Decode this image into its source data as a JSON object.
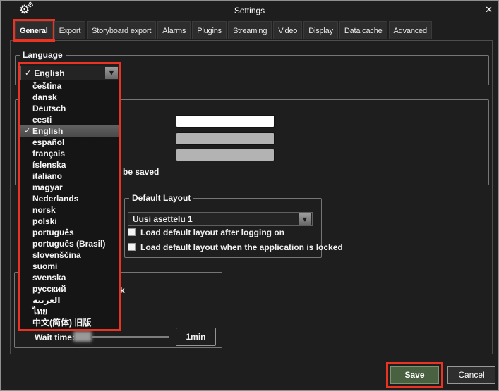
{
  "window": {
    "title": "Settings"
  },
  "icons": {
    "gear_icon": "⚙",
    "close_icon": "✕",
    "check_icon": "✓",
    "dropdown_arrow_icon": "▼"
  },
  "tabs": [
    {
      "label": "General",
      "active": true,
      "highlighted": true
    },
    {
      "label": "Export"
    },
    {
      "label": "Storyboard export"
    },
    {
      "label": "Alarms"
    },
    {
      "label": "Plugins"
    },
    {
      "label": "Streaming"
    },
    {
      "label": "Video"
    },
    {
      "label": "Display"
    },
    {
      "label": "Data cache"
    },
    {
      "label": "Advanced"
    }
  ],
  "language": {
    "group_title": "Language",
    "selected": "English",
    "options": [
      {
        "label": "čeština"
      },
      {
        "label": "dansk"
      },
      {
        "label": "Deutsch"
      },
      {
        "label": "eesti"
      },
      {
        "label": "English",
        "selected": true
      },
      {
        "label": "español"
      },
      {
        "label": "français"
      },
      {
        "label": "íslenska"
      },
      {
        "label": "italiano"
      },
      {
        "label": "magyar"
      },
      {
        "label": "Nederlands"
      },
      {
        "label": "norsk"
      },
      {
        "label": "polski"
      },
      {
        "label": "português"
      },
      {
        "label": "português (Brasil)"
      },
      {
        "label": "slovenščina"
      },
      {
        "label": "suomi"
      },
      {
        "label": "svenska"
      },
      {
        "label": "русский"
      },
      {
        "label": "العربية"
      },
      {
        "label": "ไทย"
      },
      {
        "label": "中文(简体) 旧版"
      }
    ]
  },
  "restart_section": {
    "partial_text": "be saved",
    "field_values": [
      "",
      "",
      ""
    ]
  },
  "default_layout": {
    "group_title": "Default Layout",
    "selected_layout": "Uusi asettelu 1",
    "checkboxes": [
      {
        "label": "Load default layout after logging on",
        "checked": false
      },
      {
        "label": "Load default layout when the application is locked",
        "checked": false
      }
    ]
  },
  "wait_section": {
    "partial_text": "k",
    "wait_time_label": "Wait time:",
    "wait_time_value": "1min"
  },
  "buttons": {
    "save": "Save",
    "cancel": "Cancel"
  },
  "colors": {
    "annotation_red": "#ea3323",
    "save_button_green": "#4a6141",
    "background": "#1e1e1e",
    "tab_background": "#2d2d2d",
    "selected_item_gray": "#565656"
  }
}
